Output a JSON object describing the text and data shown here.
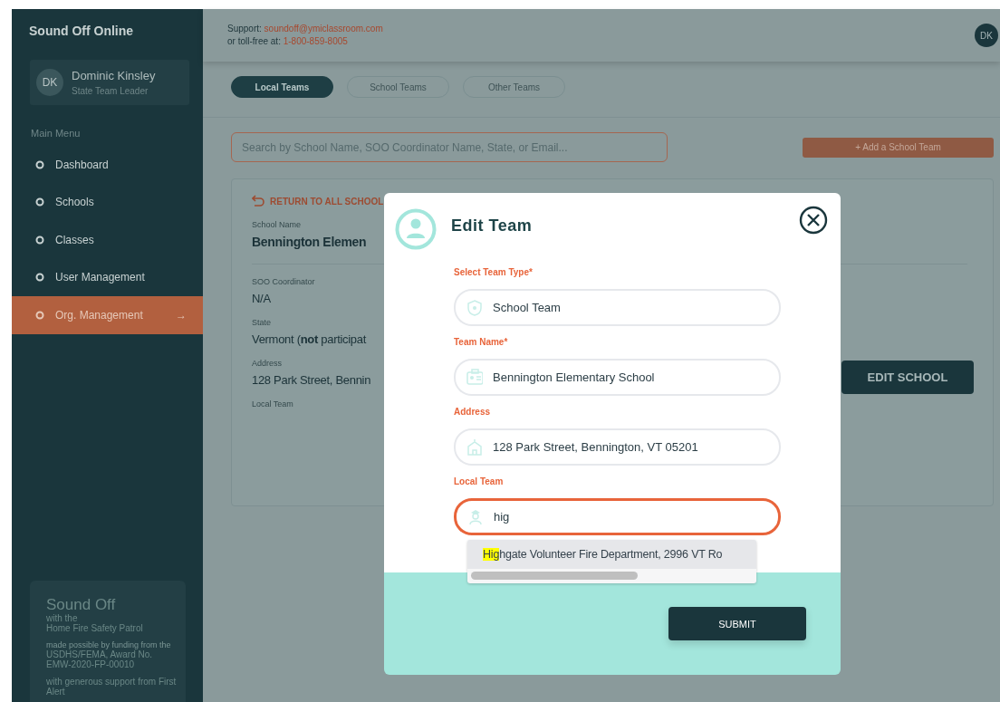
{
  "sidebar": {
    "brand": "Sound Off Online",
    "user": {
      "initials": "DK",
      "name": "Dominic Kinsley",
      "role": "State Team Leader"
    },
    "menu_heading": "Main Menu",
    "items": [
      {
        "label": "Dashboard",
        "selected": false
      },
      {
        "label": "Schools",
        "selected": false
      },
      {
        "label": "Classes",
        "selected": false
      },
      {
        "label": "User Management",
        "selected": false
      },
      {
        "label": "Org. Management",
        "selected": true,
        "arrow": "→"
      }
    ],
    "footer": [
      {
        "text": "Sound Off",
        "kind": "title"
      },
      {
        "text": "with the",
        "kind": "line"
      },
      {
        "text": "Home Fire Safety Patrol",
        "kind": "line"
      },
      {
        "text": "made possible by funding from the",
        "kind": "small"
      },
      {
        "text": "USDHS/FEMA, Award No. EMW-2020-FP-00010",
        "kind": "line"
      },
      {
        "text": "with generous support from First Alert",
        "kind": "gap"
      }
    ]
  },
  "header": {
    "support_label": "Support:",
    "email": "soundoff@ymiclassroom.com",
    "tollfree_label": "or toll-free at:",
    "phone": "1-800-859-8005",
    "avatar": "DK"
  },
  "tabs": [
    {
      "label": "Local Teams",
      "selected": true
    },
    {
      "label": "School Teams",
      "selected": false
    },
    {
      "label": "Other Teams",
      "selected": false
    }
  ],
  "search": {
    "placeholder": "Search by School Name, SOO Coordinator Name, State, or Email..."
  },
  "add_button": "+ Add a School Team",
  "school_card": {
    "return_link": "RETURN TO ALL SCHOOL",
    "fields": [
      {
        "label": "School Name",
        "value": "Bennington Elemen",
        "kind": "title"
      },
      {
        "label": "SOO Coordinator",
        "value": "N/A",
        "kind": "plain"
      },
      {
        "label": "State",
        "value": "Vermont (**not** participat",
        "kind": "plain"
      },
      {
        "label": "Address",
        "value": "128 Park Street, Bennin",
        "kind": "plain"
      },
      {
        "label": "Local Team",
        "kind": "plain"
      }
    ],
    "edit_button": "EDIT SCHOOL"
  },
  "modal": {
    "title": "Edit Team",
    "fields": [
      {
        "label": "Select Team Type*",
        "value": "School Team",
        "kind": "shield",
        "focused": false
      },
      {
        "label": "Team Name*",
        "value": "Bennington Elementary School",
        "kind": "id-card",
        "focused": false
      },
      {
        "label": "Address",
        "value": "128 Park Street, Bennington, VT 05201",
        "kind": "building",
        "focused": false
      },
      {
        "label": "Local Team",
        "value": "hig",
        "kind": "person",
        "focused": true
      }
    ],
    "suggestions": [
      {
        "match": "Hig",
        "rest": "hgate Volunteer Fire Department, 2996 VT Ro"
      }
    ],
    "submit": "SUBMIT"
  }
}
